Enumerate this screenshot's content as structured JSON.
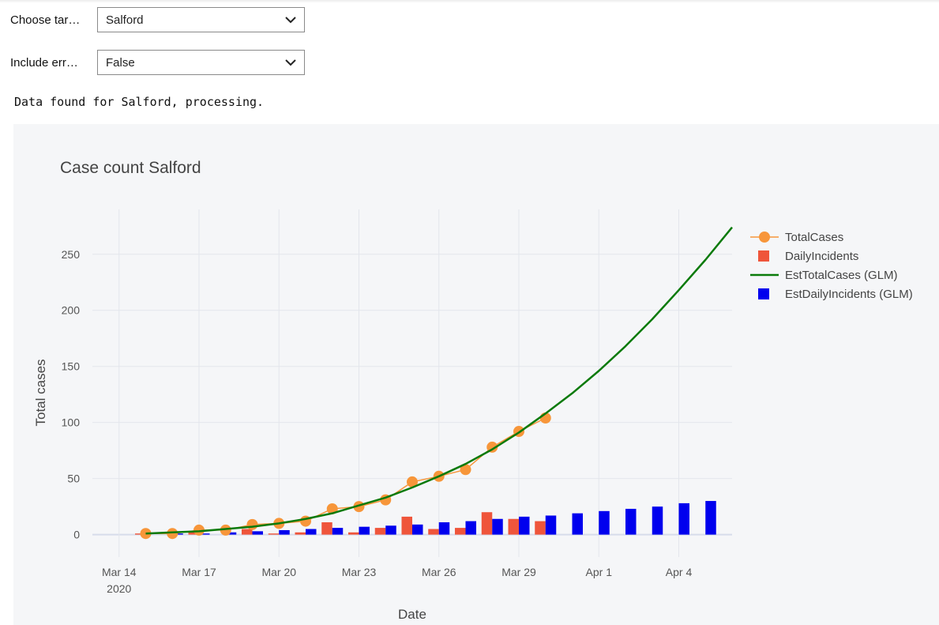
{
  "controls": {
    "target": {
      "label": "Choose tar…",
      "value": "Salford"
    },
    "errors": {
      "label": "Include err…",
      "value": "False"
    }
  },
  "status": "Data found for Salford, processing.",
  "chart_data": {
    "type": "bar",
    "title": "Case count Salford",
    "xlabel": "Date",
    "ylabel": "Total cases",
    "xlim": [
      "2020-03-13",
      "2020-04-06"
    ],
    "ylim": [
      -20,
      290
    ],
    "yticks": [
      0,
      50,
      100,
      150,
      200,
      250
    ],
    "xticks": [
      {
        "date": "2020-03-14",
        "label": "Mar 14",
        "sublabel": "2020"
      },
      {
        "date": "2020-03-17",
        "label": "Mar 17"
      },
      {
        "date": "2020-03-20",
        "label": "Mar 20"
      },
      {
        "date": "2020-03-23",
        "label": "Mar 23"
      },
      {
        "date": "2020-03-26",
        "label": "Mar 26"
      },
      {
        "date": "2020-03-29",
        "label": "Mar 29"
      },
      {
        "date": "2020-04-01",
        "label": "Apr 1"
      },
      {
        "date": "2020-04-04",
        "label": "Apr 4"
      }
    ],
    "grid": true,
    "legend_position": "right",
    "series": [
      {
        "name": "TotalCases",
        "kind": "line+markers",
        "color": "#f7963a",
        "x": [
          "2020-03-15",
          "2020-03-16",
          "2020-03-17",
          "2020-03-18",
          "2020-03-19",
          "2020-03-20",
          "2020-03-21",
          "2020-03-22",
          "2020-03-23",
          "2020-03-24",
          "2020-03-25",
          "2020-03-26",
          "2020-03-27",
          "2020-03-28",
          "2020-03-29",
          "2020-03-30"
        ],
        "y": [
          1,
          1,
          4,
          4,
          9,
          10,
          12,
          23,
          25,
          31,
          47,
          52,
          58,
          78,
          92,
          104
        ]
      },
      {
        "name": "DailyIncidents",
        "kind": "bar",
        "color": "#ef553b",
        "x": [
          "2020-03-15",
          "2020-03-16",
          "2020-03-17",
          "2020-03-18",
          "2020-03-19",
          "2020-03-20",
          "2020-03-21",
          "2020-03-22",
          "2020-03-23",
          "2020-03-24",
          "2020-03-25",
          "2020-03-26",
          "2020-03-27",
          "2020-03-28",
          "2020-03-29",
          "2020-03-30"
        ],
        "y": [
          1,
          0,
          3,
          0,
          5,
          1,
          2,
          11,
          2,
          6,
          16,
          5,
          6,
          20,
          14,
          12
        ]
      },
      {
        "name": "EstTotalCases (GLM)",
        "kind": "line",
        "color": "#0a7a0a",
        "x": [
          "2020-03-15",
          "2020-03-16",
          "2020-03-17",
          "2020-03-18",
          "2020-03-19",
          "2020-03-20",
          "2020-03-21",
          "2020-03-22",
          "2020-03-23",
          "2020-03-24",
          "2020-03-25",
          "2020-03-26",
          "2020-03-27",
          "2020-03-28",
          "2020-03-29",
          "2020-03-30",
          "2020-03-31",
          "2020-04-01",
          "2020-04-02",
          "2020-04-03",
          "2020-04-04",
          "2020-04-05",
          "2020-04-06"
        ],
        "y": [
          1,
          2,
          3,
          5,
          7,
          10,
          14,
          19,
          26,
          33,
          42,
          52,
          63,
          76,
          91,
          108,
          126,
          146,
          168,
          192,
          218,
          245,
          274
        ]
      },
      {
        "name": "EstDailyIncidents (GLM)",
        "kind": "bar",
        "color": "#0000ee",
        "x": [
          "2020-03-16",
          "2020-03-17",
          "2020-03-18",
          "2020-03-19",
          "2020-03-20",
          "2020-03-21",
          "2020-03-22",
          "2020-03-23",
          "2020-03-24",
          "2020-03-25",
          "2020-03-26",
          "2020-03-27",
          "2020-03-28",
          "2020-03-29",
          "2020-03-30",
          "2020-03-31",
          "2020-04-01",
          "2020-04-02",
          "2020-04-03",
          "2020-04-04",
          "2020-04-05"
        ],
        "y": [
          1,
          1,
          2,
          3,
          4,
          5,
          6,
          7,
          8,
          9,
          11,
          12,
          14,
          16,
          17,
          19,
          21,
          23,
          25,
          28,
          30
        ]
      }
    ]
  }
}
